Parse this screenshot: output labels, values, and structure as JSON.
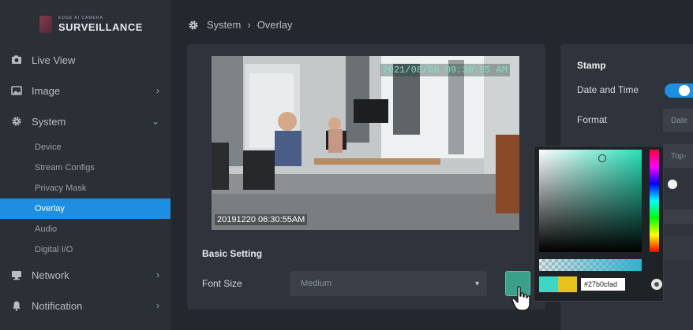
{
  "brand": {
    "small": "EDGE AI CAMERA",
    "name": "SURVEILLANCE"
  },
  "sidebar": {
    "items": [
      {
        "label": "Live View",
        "icon": "camera-icon"
      },
      {
        "label": "Image",
        "icon": "image-icon"
      },
      {
        "label": "System",
        "icon": "gear-icon"
      },
      {
        "label": "Network",
        "icon": "monitor-icon"
      },
      {
        "label": "Notification",
        "icon": "bell-icon"
      }
    ],
    "system_sub": [
      "Device",
      "Stream Configs",
      "Privacy Mask",
      "Overlay",
      "Audio",
      "Digital I/O"
    ],
    "active_sub": "Overlay"
  },
  "breadcrumb": {
    "section": "System",
    "separator": "›",
    "page": "Overlay"
  },
  "preview": {
    "timestamp_top": "2021/08/08  09:30:55 AM",
    "timestamp_bottom": "20191220 06:30:55AM"
  },
  "basic": {
    "title": "Basic Setting",
    "font_size_label": "Font Size",
    "font_size_value": "Medium"
  },
  "stamp": {
    "title": "Stamp",
    "date_time_label": "Date and Time",
    "date_time_enabled": true,
    "format_label": "Format",
    "format_value": "Date",
    "position_value": "Top-"
  },
  "color_picker": {
    "hex": "#27b0cfad",
    "current_color": "#3fd6c4",
    "previous_color": "#e8c21c"
  },
  "colors": {
    "accent": "#1e8fe0",
    "sidebar_bg": "#2b2f36",
    "page_bg": "#23272e",
    "card_bg": "#2f343c"
  }
}
